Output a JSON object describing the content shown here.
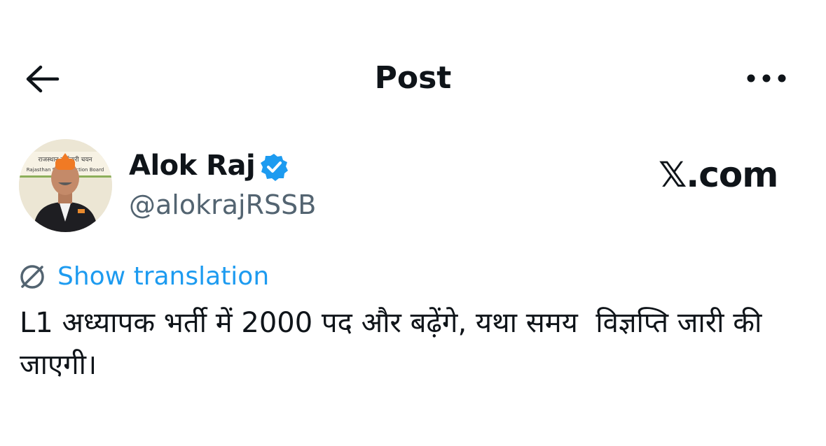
{
  "header": {
    "title": "Post",
    "back_icon": "arrow-left-icon",
    "more_icon": "more-horizontal-icon"
  },
  "author": {
    "display_name": "Alok Raj",
    "handle": "@alokrajRSSB",
    "verified": true,
    "verified_color": "#1d9bf0",
    "avatar_banner_lines": [
      "राजस्थान कर्मचारी चयन",
      "Rajasthan Staff Selection Board"
    ]
  },
  "watermark": {
    "text": "𝕏.com"
  },
  "translation": {
    "label": "Show translation",
    "icon": "globe-slash-icon",
    "color": "#1d9bf0"
  },
  "post": {
    "text": "L1 अध्यापक भर्ती में 2000 पद और बढ़ेंगे, यथा समय  विज्ञप्ति जारी की जाएगी।"
  }
}
